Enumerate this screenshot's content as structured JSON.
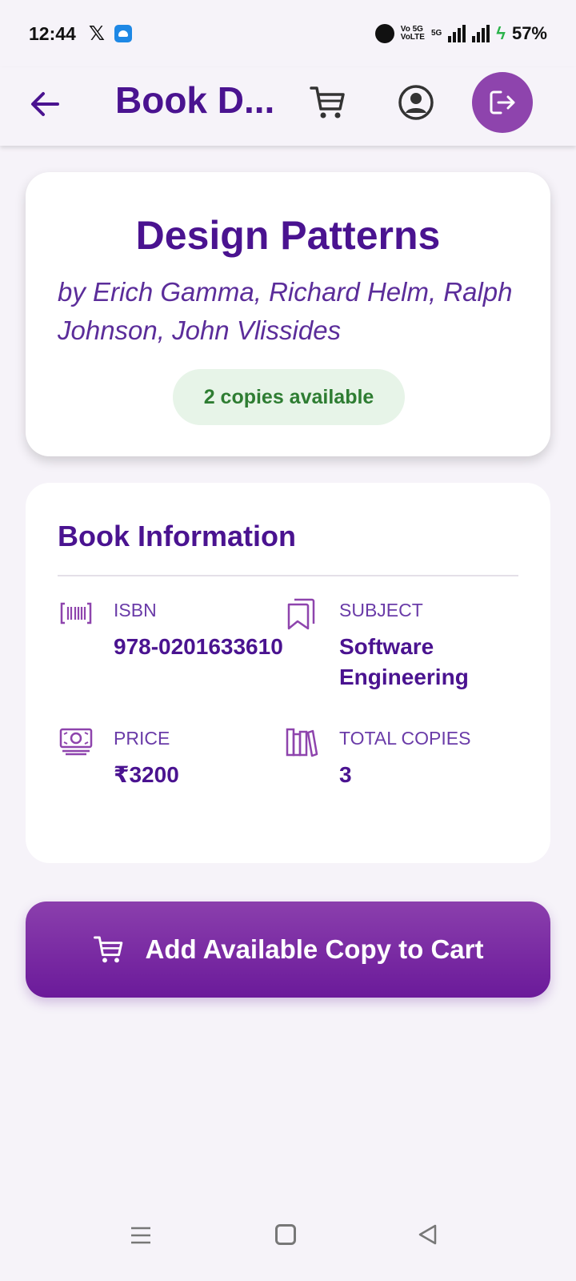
{
  "status_bar": {
    "time": "12:44",
    "x_app": "𝕏",
    "network": "Vo 5G\nVoLTE",
    "network_gen": "5G",
    "battery": "57%"
  },
  "app_bar": {
    "title": "Book D...",
    "back_icon": "arrow-left-icon",
    "cart_icon": "cart-icon",
    "profile_icon": "account-circle-icon",
    "logout_icon": "logout-icon"
  },
  "book": {
    "title": "Design Patterns",
    "authors": "by Erich Gamma, Richard Helm, Ralph Johnson, John Vlissides",
    "availability": "2 copies available"
  },
  "info": {
    "heading": "Book Information",
    "isbn": {
      "label": "ISBN",
      "value": "978-0201633610",
      "icon": "barcode-icon"
    },
    "subject": {
      "label": "SUBJECT",
      "value": "Software Engineering",
      "icon": "bookmarks-icon"
    },
    "price": {
      "label": "PRICE",
      "value": "₹3200",
      "icon": "money-icon"
    },
    "total_copies": {
      "label": "TOTAL COPIES",
      "value": "3",
      "icon": "library-books-icon"
    }
  },
  "actions": {
    "add_to_cart": "Add Available Copy to Cart"
  },
  "colors": {
    "primary": "#4a1390",
    "accent": "#8e44ad",
    "available": "#2e7d32",
    "available_bg": "#e7f4e8"
  }
}
